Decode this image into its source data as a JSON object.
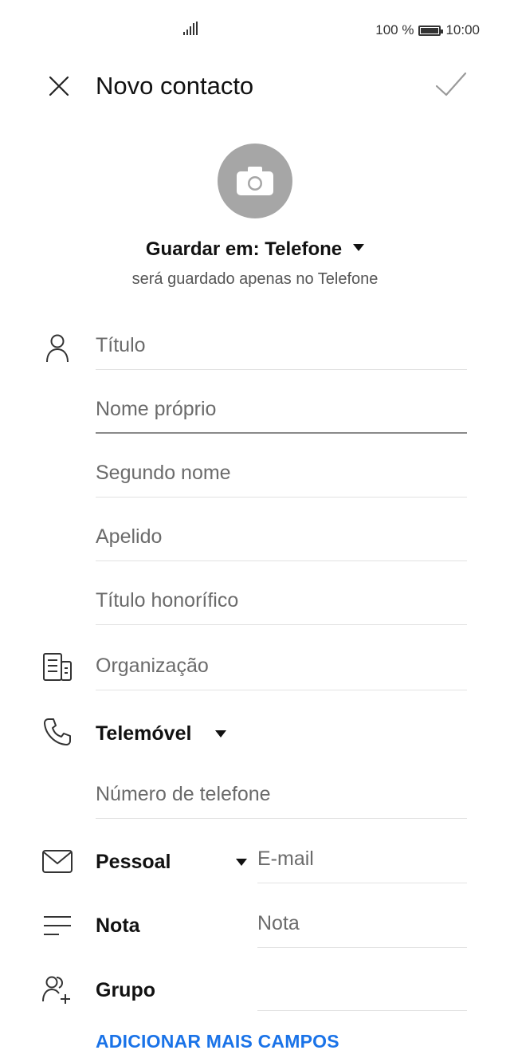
{
  "status_bar": {
    "battery_percent": "100 %",
    "time": "10:00"
  },
  "header": {
    "title": "Novo contacto"
  },
  "save_location": {
    "label": "Guardar em: Telefone",
    "hint": "será guardado apenas no Telefone"
  },
  "fields": {
    "title": {
      "placeholder": "Título"
    },
    "first_name": {
      "placeholder": "Nome próprio"
    },
    "middle_name": {
      "placeholder": "Segundo nome"
    },
    "last_name": {
      "placeholder": "Apelido"
    },
    "honorific": {
      "placeholder": "Título honorífico"
    },
    "organization": {
      "placeholder": "Organização"
    },
    "phone_type": {
      "label": "Telemóvel"
    },
    "phone_number": {
      "placeholder": "Número de telefone"
    },
    "email_type": {
      "label": "Pessoal"
    },
    "email": {
      "placeholder": "E-mail"
    },
    "note_label": {
      "label": "Nota"
    },
    "note": {
      "placeholder": "Nota"
    },
    "group_label": {
      "label": "Grupo"
    }
  },
  "actions": {
    "add_more_fields": "ADICIONAR MAIS CAMPOS"
  },
  "colors": {
    "accent": "#1a73e8",
    "avatar_bg": "#a6a6a6"
  }
}
